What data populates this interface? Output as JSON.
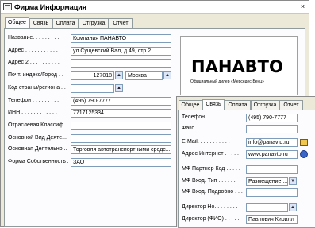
{
  "window": {
    "title": "Фирма Информация",
    "close_label": "×"
  },
  "back_tabs": [
    "Общее",
    "Связь",
    "Оплата",
    "Отгрузка",
    "Отчет"
  ],
  "general": {
    "name": {
      "label": "Название. . . . . . . . .",
      "value": "Компания ПАНАВТО"
    },
    "address": {
      "label": "Адрес . . . . . . . . . . .",
      "value": "ул Сущевский Вал, д.49, стр.2"
    },
    "address2": {
      "label": "Адрес 2 . . . . . . . . . .",
      "value": ""
    },
    "postal": {
      "label": "Почт. индекс/Город . .",
      "value": "127018",
      "city": "Москва"
    },
    "country": {
      "label": "Код страны/региона . .",
      "value": ""
    },
    "phone": {
      "label": "Телефон . . . . . . . . .",
      "value": "(495) 790-7777"
    },
    "inn": {
      "label": "ИНН . . . . . . . . . . . .",
      "value": "7717125334"
    },
    "industry": {
      "label": "Отраслевая Классиф...",
      "value": ""
    },
    "main_activity": {
      "label": "Основной Вид Деяте...",
      "value": ""
    },
    "main_activity2": {
      "label": "Основная Деятельно...",
      "value": "Торговля автотранспортными средс..."
    },
    "ownership": {
      "label": "Форма Собственность . .",
      "value": "ЗАО"
    }
  },
  "logo": {
    "text": "ПАНАВТО",
    "subtitle": "Официальный дилер «Мерседес-Бенц»"
  },
  "front_tabs": [
    "Общее",
    "Связь",
    "Оплата",
    "Отгрузка",
    "Отчет"
  ],
  "contact": {
    "phone": {
      "label": "Телефон . . . . . . . . .",
      "value": "(495) 790-7777"
    },
    "fax": {
      "label": "Факс . . . . . . . . . . . .",
      "value": ""
    },
    "email": {
      "label": "E-Mail. . . . . . . . . . . .",
      "value": "info@panavto.ru"
    },
    "website": {
      "label": "Адрес Интернет . . . . .",
      "value": "www.panavto.ru"
    },
    "mf_partner": {
      "label": "МФ Партнер Код . . . . .",
      "value": ""
    },
    "mf_type": {
      "label": "МФ Вход. Тип . . . . . .",
      "value": "Размещение ..."
    },
    "mf_detail": {
      "label": "МФ Вход. Подробно . . .",
      "value": ""
    },
    "director_no": {
      "label": "Директор Но. . . . . . . .",
      "value": ""
    },
    "director_name": {
      "label": "Директор (ФИО) . . . . .",
      "value": "Павлович Кирилл"
    }
  },
  "icons": {
    "dropdown": "dropdown-arrow-icon",
    "mail": "mail-icon",
    "globe": "globe-icon",
    "app": "form-icon"
  }
}
